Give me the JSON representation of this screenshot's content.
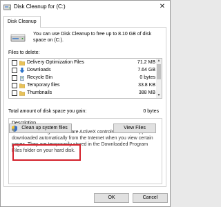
{
  "window": {
    "title": "Disk Cleanup for  (C:)"
  },
  "tabs": [
    {
      "label": "Disk Cleanup"
    }
  ],
  "intro_text": "You can use Disk Cleanup to free up to 8.10 GB of disk space on  (C:).",
  "files_label": "Files to delete:",
  "file_rows": [
    {
      "name": "Delivery Optimization Files",
      "size": "71.2 MB",
      "icon": "folder-icon",
      "checked": false
    },
    {
      "name": "Downloads",
      "size": "7.64 GB",
      "icon": "download-arrow-icon",
      "checked": false
    },
    {
      "name": "Recycle Bin",
      "size": "0 bytes",
      "icon": "recycle-bin-icon",
      "checked": false
    },
    {
      "name": "Temporary files",
      "size": "33.8 KB",
      "icon": "folder-icon",
      "checked": false
    },
    {
      "name": "Thumbnails",
      "size": "388 MB",
      "icon": "folder-icon",
      "checked": false
    }
  ],
  "total_label": "Total amount of disk space you gain:",
  "total_value": "0 bytes",
  "description": {
    "legend": "Description",
    "text": "Downloaded Program Files are ActiveX controls and Java applets downloaded automatically from the Internet when you view certain pages. They are temporarily stored in the Downloaded Program Files folder on your hard disk."
  },
  "buttons": {
    "cleanup_system": "Clean up system files",
    "view_files": "View Files",
    "ok": "OK",
    "cancel": "Cancel"
  },
  "colors": {
    "highlight": "#d3202a",
    "folder": "#e8c25a",
    "download_arrow": "#2a72c8"
  }
}
